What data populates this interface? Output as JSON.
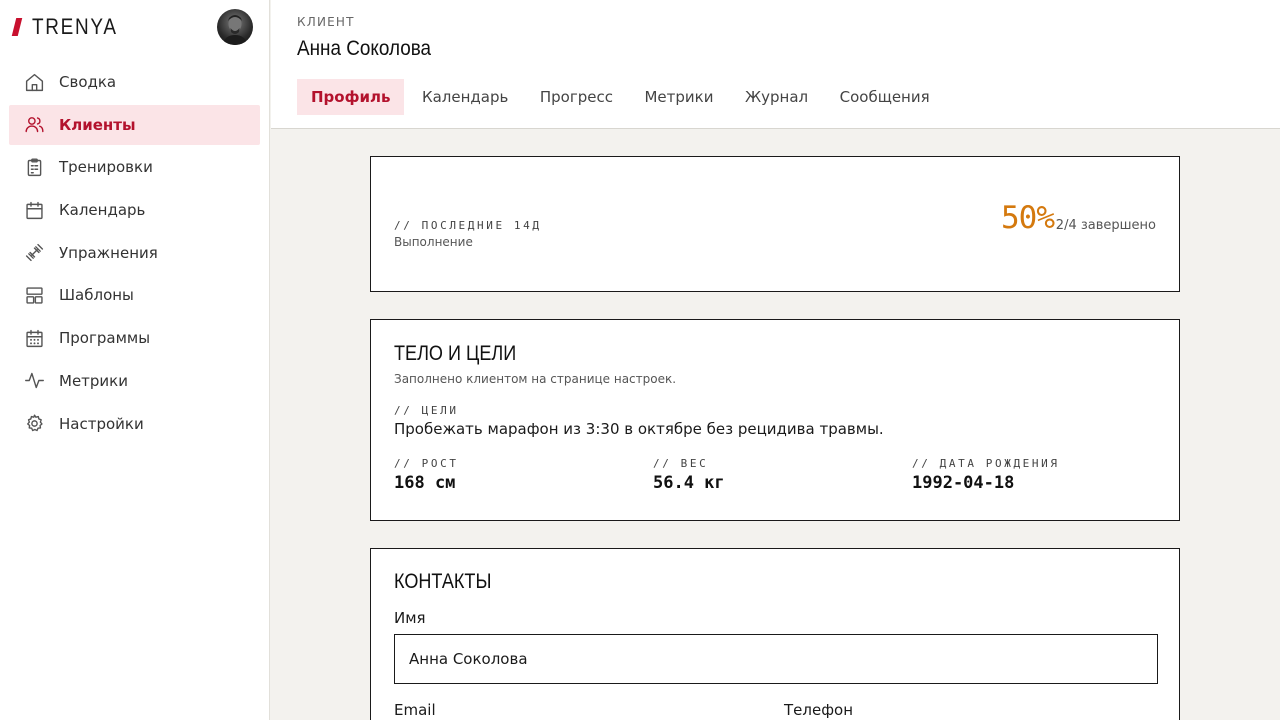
{
  "brand": {
    "name": "TRENYA",
    "accent": "#c8102e"
  },
  "sidebar": {
    "items": [
      {
        "label": "Сводка",
        "icon": "home-icon",
        "active": false
      },
      {
        "label": "Клиенты",
        "icon": "users-icon",
        "active": true
      },
      {
        "label": "Тренировки",
        "icon": "clipboard-icon",
        "active": false
      },
      {
        "label": "Календарь",
        "icon": "calendar-icon",
        "active": false
      },
      {
        "label": "Упражнения",
        "icon": "dumbbell-icon",
        "active": false
      },
      {
        "label": "Шаблоны",
        "icon": "layout-icon",
        "active": false
      },
      {
        "label": "Программы",
        "icon": "calendar-grid-icon",
        "active": false
      },
      {
        "label": "Метрики",
        "icon": "activity-icon",
        "active": false
      },
      {
        "label": "Настройки",
        "icon": "gear-icon",
        "active": false
      }
    ]
  },
  "header": {
    "overline": "КЛИЕНТ",
    "client_name": "Анна Соколова",
    "tabs": [
      {
        "label": "Профиль",
        "active": true
      },
      {
        "label": "Календарь",
        "active": false
      },
      {
        "label": "Прогресс",
        "active": false
      },
      {
        "label": "Метрики",
        "active": false
      },
      {
        "label": "Журнал",
        "active": false
      },
      {
        "label": "Сообщения",
        "active": false
      }
    ]
  },
  "completion": {
    "kicker": "// ПОСЛЕДНИЕ 14Д",
    "label": "Выполнение",
    "percent": "50%",
    "summary": "2/4 завершено",
    "accent": "#d4790e"
  },
  "body_goals": {
    "title": "ТЕЛО И ЦЕЛИ",
    "subtitle": "Заполнено клиентом на странице настроек.",
    "goals_kicker": "// ЦЕЛИ",
    "goals_text": "Пробежать марафон из 3:30 в октябре без рецидива травмы.",
    "stats": [
      {
        "label": "// РОСТ",
        "value": "168 см"
      },
      {
        "label": "// ВЕС",
        "value": "56.4 кг"
      },
      {
        "label": "// ДАТА РОЖДЕНИЯ",
        "value": "1992-04-18"
      }
    ]
  },
  "contacts": {
    "title": "КОНТАКТЫ",
    "name_label": "Имя",
    "name_value": "Анна Соколова",
    "email_label": "Email",
    "phone_label": "Телефон"
  }
}
